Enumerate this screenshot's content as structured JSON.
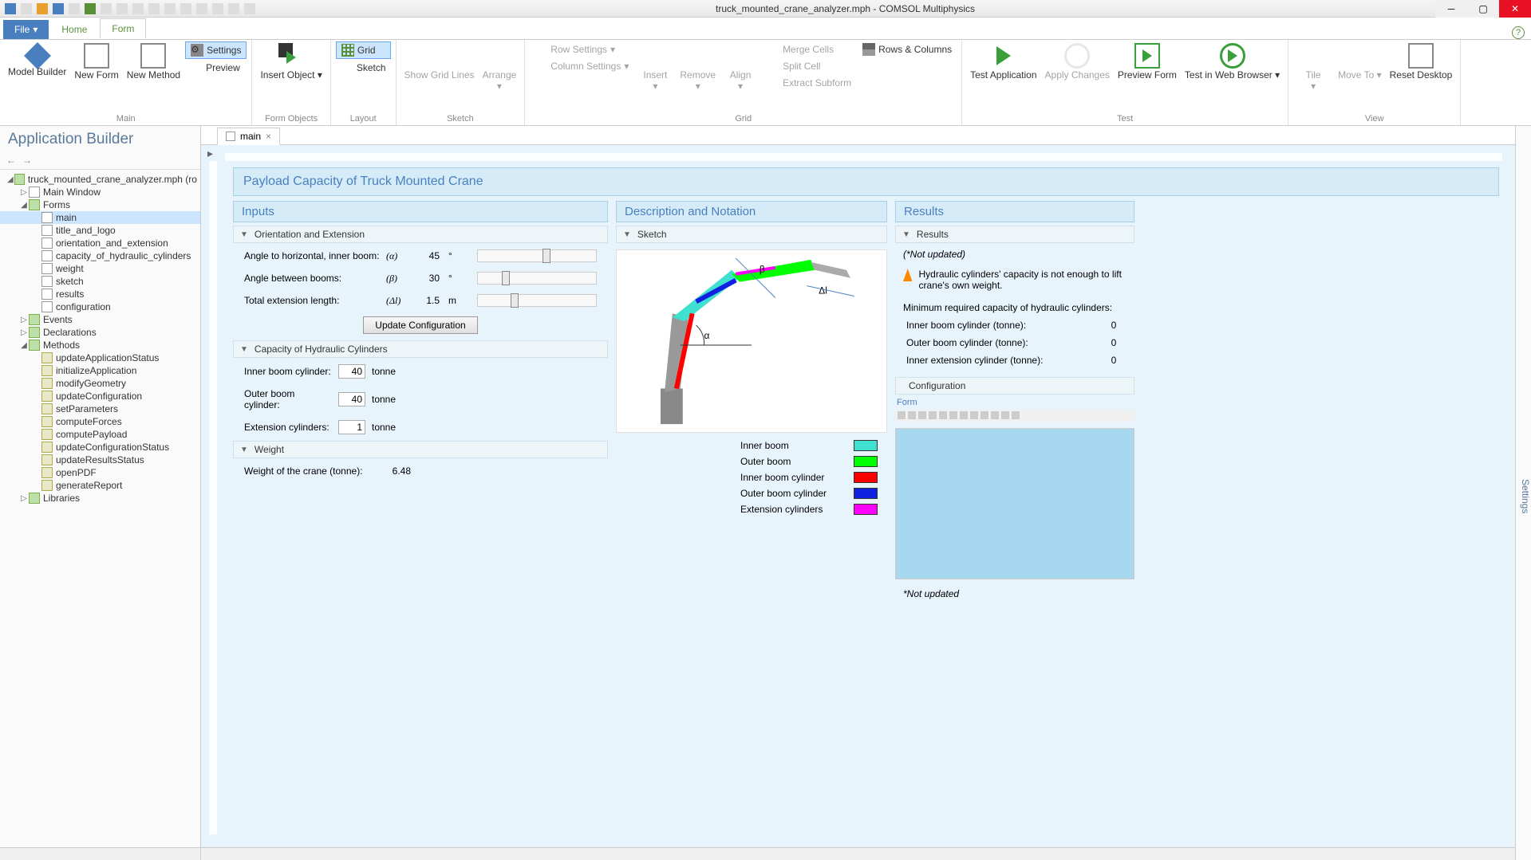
{
  "titlebar": {
    "title": "truck_mounted_crane_analyzer.mph - COMSOL Multiphysics"
  },
  "menutabs": {
    "file": "File",
    "home": "Home",
    "form": "Form"
  },
  "ribbon": {
    "main": {
      "label": "Main",
      "model_builder": "Model\nBuilder",
      "new_form": "New\nForm",
      "new_method": "New\nMethod",
      "settings": "Settings",
      "preview": "Preview"
    },
    "form_objects": {
      "label": "Form Objects",
      "insert_object": "Insert\nObject"
    },
    "layout": {
      "label": "Layout",
      "grid": "Grid",
      "sketch": "Sketch"
    },
    "sketch": {
      "label": "Sketch",
      "show_grid": "Show Grid\nLines",
      "arrange": "Arrange"
    },
    "grid": {
      "label": "Grid",
      "row_settings": "Row Settings",
      "column_settings": "Column Settings",
      "insert": "Insert",
      "remove": "Remove",
      "align": "Align",
      "merge": "Merge Cells",
      "split": "Split Cell",
      "extract": "Extract Subform",
      "rows_cols": "Rows & Columns"
    },
    "test": {
      "label": "Test",
      "test_app": "Test\nApplication",
      "apply": "Apply\nChanges",
      "preview_form": "Preview\nForm",
      "test_web": "Test in Web\nBrowser"
    },
    "view": {
      "label": "View",
      "tile": "Tile",
      "move_to": "Move\nTo",
      "reset": "Reset\nDesktop"
    }
  },
  "left": {
    "title": "Application Builder",
    "root": "truck_mounted_crane_analyzer.mph (ro",
    "main_window": "Main Window",
    "forms": "Forms",
    "form_items": [
      "main",
      "title_and_logo",
      "orientation_and_extension",
      "capacity_of_hydraulic_cylinders",
      "weight",
      "sketch",
      "results",
      "configuration"
    ],
    "events": "Events",
    "declarations": "Declarations",
    "methods": "Methods",
    "method_items": [
      "updateApplicationStatus",
      "initializeApplication",
      "modifyGeometry",
      "updateConfiguration",
      "setParameters",
      "computeForces",
      "computePayload",
      "updateConfigurationStatus",
      "updateResultsStatus",
      "openPDF",
      "generateReport"
    ],
    "libraries": "Libraries"
  },
  "tab": {
    "name": "main"
  },
  "form": {
    "header": "Payload Capacity of Truck Mounted Crane",
    "inputs": {
      "title": "Inputs",
      "orientation": {
        "title": "Orientation and Extension",
        "angle_inner": {
          "label": "Angle to horizontal, inner boom:",
          "sym": "(α)",
          "val": "45",
          "unit": "°"
        },
        "angle_between": {
          "label": "Angle between booms:",
          "sym": "(β)",
          "val": "30",
          "unit": "°"
        },
        "extension": {
          "label": "Total extension length:",
          "sym": "(Δl)",
          "val": "1.5",
          "unit": "m"
        },
        "update_btn": "Update Configuration"
      },
      "capacity": {
        "title": "Capacity of Hydraulic Cylinders",
        "inner": {
          "label": "Inner boom cylinder:",
          "val": "40",
          "unit": "tonne"
        },
        "outer": {
          "label": "Outer boom cylinder:",
          "val": "40",
          "unit": "tonne"
        },
        "ext": {
          "label": "Extension cylinders:",
          "val": "1",
          "unit": "tonne"
        }
      },
      "weight": {
        "title": "Weight",
        "label": "Weight of the crane (tonne):",
        "val": "6.48"
      }
    },
    "desc": {
      "title": "Description and Notation",
      "sketch": "Sketch",
      "legend": {
        "inner_boom": "Inner boom",
        "outer_boom": "Outer boom",
        "inner_cyl": "Inner boom cylinder",
        "outer_cyl": "Outer boom cylinder",
        "ext_cyl": "Extension cylinders"
      },
      "colors": {
        "inner_boom": "#40e0d0",
        "outer_boom": "#00ff00",
        "inner_cyl": "#ff0000",
        "outer_cyl": "#1020e0",
        "ext_cyl": "#ff00ff"
      }
    },
    "results": {
      "title": "Results",
      "sub": "Results",
      "not_updated": "(*Not updated)",
      "warning": "Hydraulic cylinders' capacity is not enough to lift crane's own weight.",
      "min_req": "Minimum required capacity of hydraulic cylinders:",
      "inner": {
        "label": "Inner boom cylinder (tonne):",
        "val": "0"
      },
      "outer": {
        "label": "Outer boom cylinder (tonne):",
        "val": "0"
      },
      "ext": {
        "label": "Inner extension cylinder (tonne):",
        "val": "0"
      },
      "config": "Configuration",
      "form_lbl": "Form",
      "footnote": "*Not updated"
    }
  },
  "right_strip": "Settings"
}
